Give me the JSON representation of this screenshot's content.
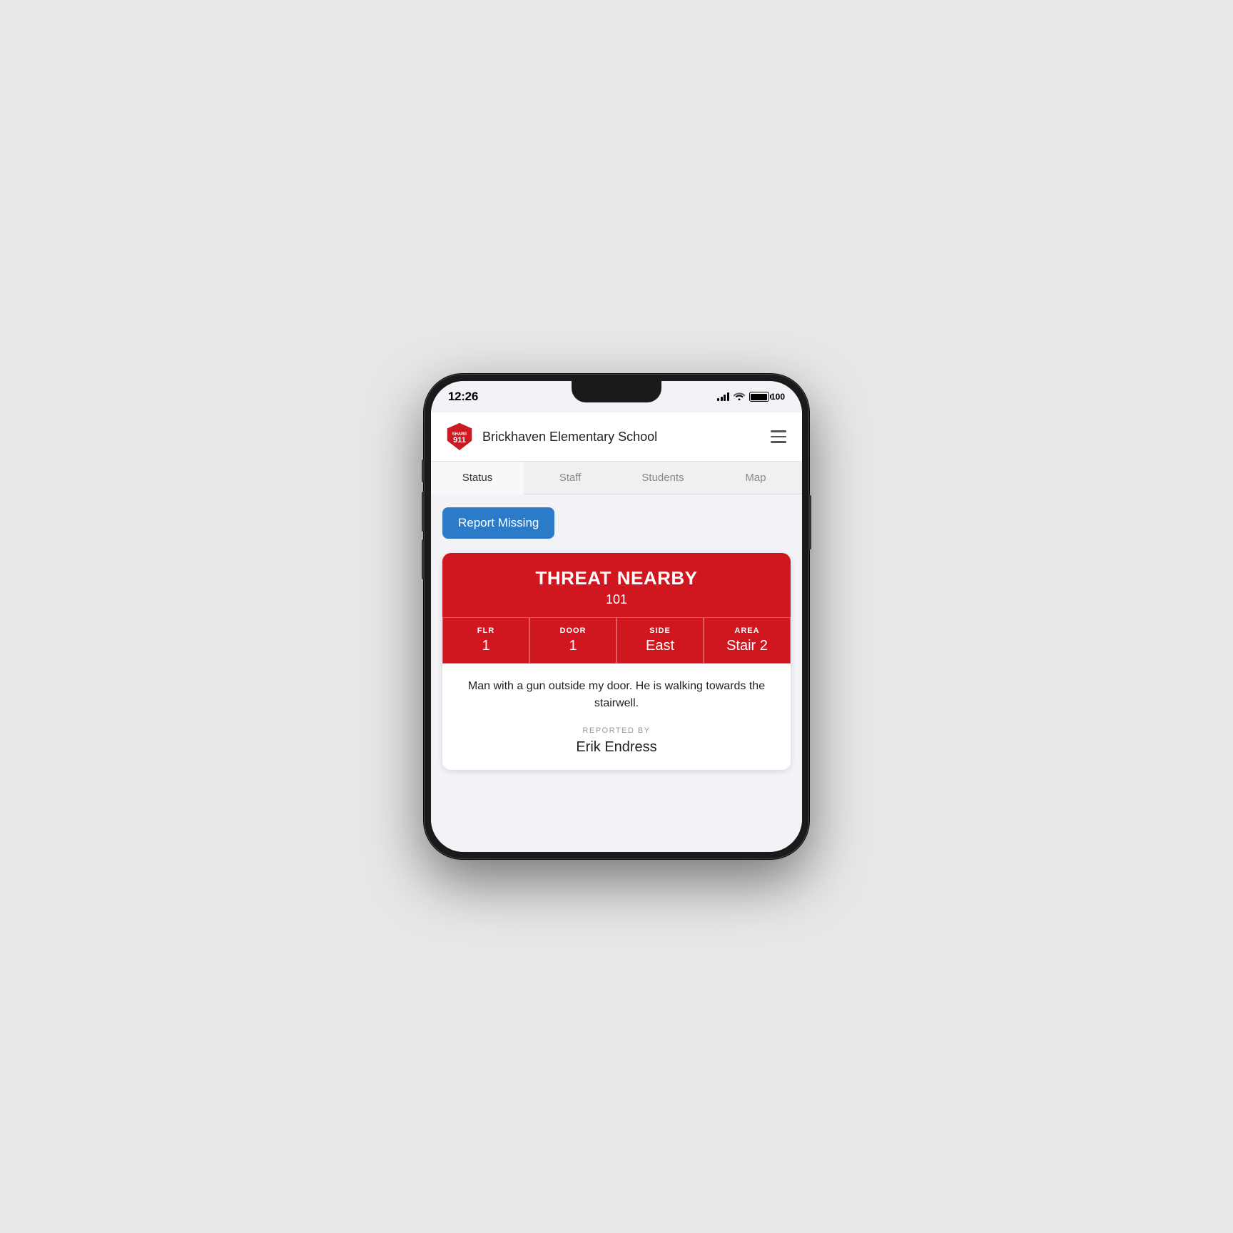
{
  "statusBar": {
    "time": "12:26",
    "batteryPercent": "100"
  },
  "header": {
    "title": "Brickhaven Elementary School",
    "logoAlt": "Share911 Logo"
  },
  "tabs": [
    {
      "label": "Status",
      "active": true
    },
    {
      "label": "Staff",
      "active": false
    },
    {
      "label": "Students",
      "active": false
    },
    {
      "label": "Map",
      "active": false
    }
  ],
  "reportMissingButton": "Report Missing",
  "threatCard": {
    "title": "THREAT NEARBY",
    "number": "101",
    "grid": [
      {
        "label": "FLR",
        "value": "1"
      },
      {
        "label": "DOOR",
        "value": "1"
      },
      {
        "label": "SIDE",
        "value": "East"
      },
      {
        "label": "AREA",
        "value": "Stair 2"
      }
    ],
    "description": "Man with a gun outside my door. He is walking towards the stairwell.",
    "reportedByLabel": "REPORTED BY",
    "reportedByName": "Erik Endress"
  }
}
